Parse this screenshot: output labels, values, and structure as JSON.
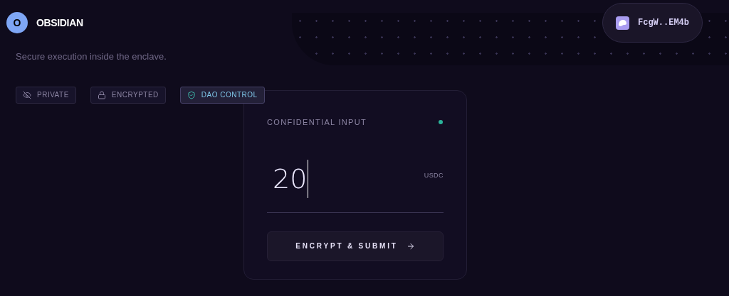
{
  "brand": {
    "initial": "O",
    "name": "OBSIDIAN"
  },
  "wallet": {
    "address": "FcgW..EM4b"
  },
  "subtitle": "Secure execution inside the enclave.",
  "badges": [
    {
      "kind": "private",
      "label": "PRIVATE",
      "selected": false
    },
    {
      "kind": "encrypted",
      "label": "ENCRYPTED",
      "selected": false
    },
    {
      "kind": "dao",
      "label": "DAO CONTROL",
      "selected": true
    }
  ],
  "card": {
    "title": "CONFIDENTIAL INPUT",
    "online": true,
    "amount": "20",
    "unit": "USDC",
    "button": "ENCRYPT & SUBMIT"
  }
}
